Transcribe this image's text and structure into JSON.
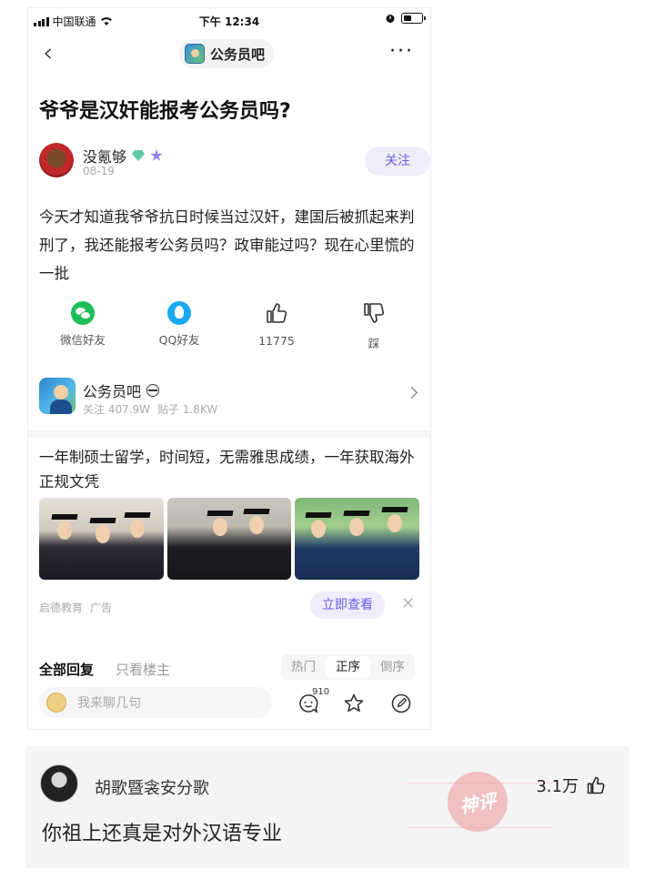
{
  "status_bar": {
    "carrier": "中国联通",
    "time": "下午 12:34"
  },
  "nav": {
    "forum_name": "公务员吧",
    "more": "···"
  },
  "post": {
    "title": "爷爷是汉奸能报考公务员吗?",
    "author": {
      "name": "没氪够",
      "date": "08-19",
      "follow_label": "关注"
    },
    "content": "今天才知道我爷爷抗日时候当过汉奸，建国后被抓起来判刑了，我还能报考公务员吗？政审能过吗？现在心里慌的一批"
  },
  "actions": [
    {
      "label": "微信好友",
      "icon": "wechat-icon"
    },
    {
      "label": "QQ好友",
      "icon": "qq-icon"
    },
    {
      "label": "11775",
      "icon": "thumbs-up-icon"
    },
    {
      "label": "踩",
      "icon": "thumbs-down-icon"
    }
  ],
  "forum": {
    "name": "公务员吧",
    "followers": "关注 407.9W",
    "posts": "贴子 1.8KW"
  },
  "ad": {
    "text": "一年制硕士留学，时间短，无需雅思成绩，一年获取海外正规文凭",
    "advertiser": "启德教育",
    "tag": "广告",
    "cta_label": "立即查看",
    "close": "✕"
  },
  "replies": {
    "tab_all": "全部回复",
    "tab_owner": "只看楼主",
    "sort_options": [
      "热门",
      "正序",
      "倒序"
    ],
    "selected_sort": "正序",
    "input_placeholder": "我来聊几句",
    "comment_count": "910"
  },
  "featured_comment": {
    "user": "胡歌暨衾安分歌",
    "likes": "3.1万",
    "text": "你祖上还真是对外汉语专业",
    "stamp": "神评"
  },
  "colors": {
    "accent": "#6a5fe0",
    "accent_bg": "#efedfc",
    "wechat": "#1dbe5a",
    "qq": "#19a8f2"
  }
}
